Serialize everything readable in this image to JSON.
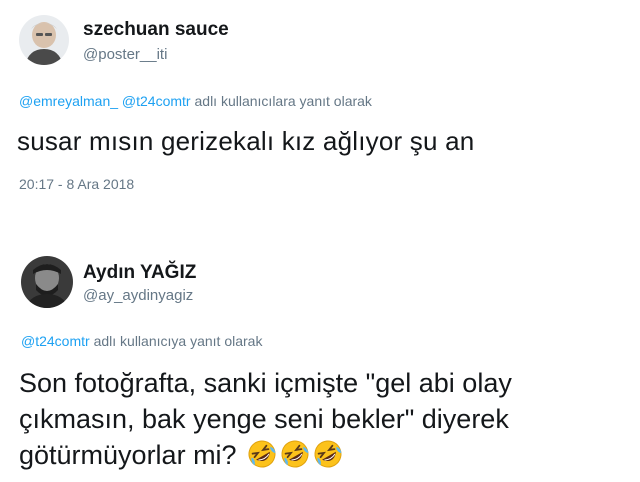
{
  "tweet1": {
    "display_name": "szechuan sauce",
    "handle": "@poster__iti",
    "reply_mentions": [
      "@emreyalman_",
      "@t24comtr"
    ],
    "reply_suffix": "adlı kullanıcılara yanıt olarak",
    "text": "susar mısın gerizekalı kız ağlıyor şu an",
    "timestamp": "20:17 - 8 Ara 2018"
  },
  "tweet2": {
    "display_name": "Aydın YAĞIZ",
    "handle": "@ay_aydinyagiz",
    "reply_mentions": [
      "@t24comtr"
    ],
    "reply_suffix": "adlı kullanıcıya yanıt olarak",
    "text_lines": [
      "Son fotoğrafta, sanki içmişte \"gel abi olay",
      "çıkmasın, bak yenge seni bekler\" diyerek",
      "götürmüyorlar mi?"
    ],
    "emojis": [
      "rolling-on-floor-laughing-icon",
      "rolling-on-floor-laughing-icon",
      "rolling-on-floor-laughing-icon"
    ]
  },
  "colors": {
    "text": "#14171a",
    "secondary": "#657786",
    "link": "#1da1f2",
    "emoji_yellow": "#fcc21b"
  }
}
